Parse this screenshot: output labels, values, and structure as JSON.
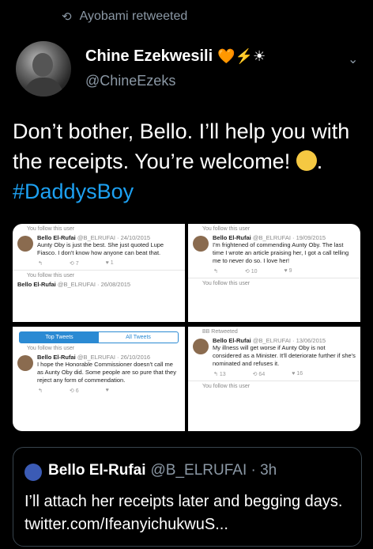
{
  "retweet": {
    "label": "Ayobami retweeted"
  },
  "author": {
    "name": "Chine Ezekwesili",
    "name_emojis": "🧡⚡☀",
    "handle": "@ChineEzeks"
  },
  "tweet": {
    "text_before": "Don’t bother, Bello. I’ll help you with the receipts. You’re welcome! ",
    "text_after": ". ",
    "hashtag": "#DaddysBoy"
  },
  "media": {
    "shot1": {
      "meta": "You follow this user",
      "name": "Bello El-Rufai",
      "handle_date": "@B_ELRUFAI · 24/10/2015",
      "body": "Aunty Oby is just the best. She just quoted Lupe Fiasco. I don't know how anyone can beat that.",
      "counts": [
        "7",
        "1"
      ],
      "meta2": "You follow this user",
      "name2": "Bello El-Rufai",
      "handle_date2": "@B_ELRUFAI · 26/08/2015"
    },
    "shot2": {
      "meta": "You follow this user",
      "name": "Bello El-Rufai",
      "handle_date": "@B_ELRUFAI · 19/09/2015",
      "body": "I'm frightened of commending Aunty Oby. The last time I wrote an article praising her, I got a call telling me to never do so. I love her!",
      "counts": [
        "10",
        "9"
      ],
      "meta2": "You follow this user"
    },
    "shot3": {
      "tab_top": "Top Tweets",
      "tab_all": "All Tweets",
      "meta": "You follow this user",
      "name": "Bello El-Rufai",
      "handle_date": "@B_ELRUFAI · 26/10/2016",
      "body": "I hope the Honorable Commissioner doesn't call me as Aunty Oby did. Some people are so pure that they reject any form of commendation.",
      "counts": [
        "6"
      ]
    },
    "shot4": {
      "meta": "BB Retweeted",
      "name": "Bello El-Rufai",
      "handle_date": "@B_ELRUFAI · 13/06/2015",
      "body": "My illness will get worse if Aunty Oby is not considered as a Minister. It'll deteriorate further if she's nominated and refuses it.",
      "counts": [
        "13",
        "64",
        "16"
      ],
      "meta2": "You follow this user"
    }
  },
  "quote": {
    "name": "Bello El-Rufai",
    "handle_time": "@B_ELRUFAI · 3h",
    "text": "I’ll attach her receipts later and begging days. twitter.com/IfeanyichukwuS..."
  },
  "colors": {
    "link": "#1da1f2",
    "muted": "#8b98a5",
    "background": "#000000"
  }
}
